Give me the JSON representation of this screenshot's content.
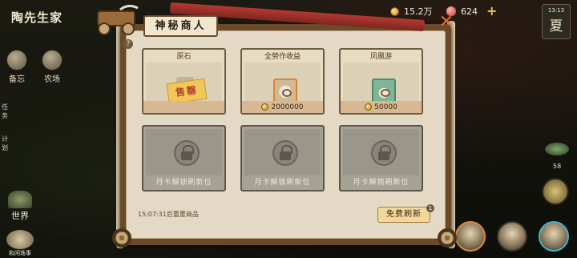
{
  "header": {
    "title": "陶先生家",
    "coins": "15.2万",
    "gems": "624",
    "season_label": "13:13",
    "season": "夏"
  },
  "left_menu": {
    "items": [
      {
        "label": "备忘"
      },
      {
        "label": "农场"
      }
    ],
    "vertical_1": "任务",
    "vertical_2": "计划",
    "world": "世界",
    "badge": "和闲逸事"
  },
  "right_panel": {
    "counter": "58"
  },
  "shop": {
    "title": "神秘商人",
    "help": "?",
    "close": "✕",
    "slots": [
      {
        "name": "原石",
        "status": "售罄",
        "price": ""
      },
      {
        "name": "全勞作收益",
        "status": "",
        "price": "2000000"
      },
      {
        "name": "凤凰游",
        "status": "",
        "price": "50000"
      }
    ],
    "locked_slots": [
      {
        "caption": "月卡解锁刷新位"
      },
      {
        "caption": "月卡解锁刷新位"
      },
      {
        "caption": "月卡解锁刷新位"
      }
    ],
    "refresh_timer": "15:07:31后重置商品",
    "free_refresh": "免费刷新",
    "refresh_badge": "1"
  },
  "colors": {
    "accent_close": "#e86a2a",
    "gold": "#f2c547",
    "ribbon": "#b33a32"
  }
}
